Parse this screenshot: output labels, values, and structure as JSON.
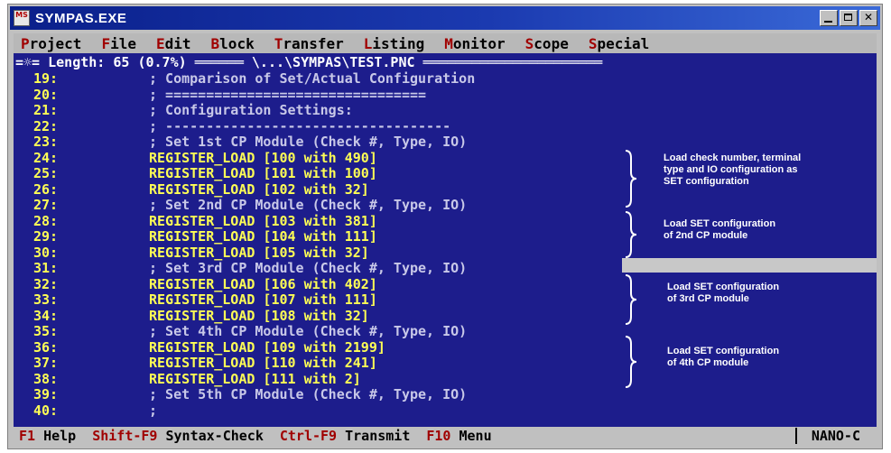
{
  "window": {
    "title": "SYMPAS.EXE",
    "icon_text": "MS",
    "buttons": [
      "minimize",
      "maximize",
      "close"
    ]
  },
  "menu": [
    {
      "hotkey": "P",
      "rest": "roject"
    },
    {
      "hotkey": "F",
      "rest": "ile"
    },
    {
      "hotkey": "E",
      "rest": "dit"
    },
    {
      "hotkey": "B",
      "rest": "lock"
    },
    {
      "hotkey": "T",
      "rest": "ransfer"
    },
    {
      "hotkey": "L",
      "rest": "isting"
    },
    {
      "hotkey": "M",
      "rest": "onitor"
    },
    {
      "hotkey": "S",
      "rest": "cope"
    },
    {
      "hotkey": "S",
      "rest": "pecial"
    }
  ],
  "status": "=☼= Length: 65 (0.7%) ══════ \\...\\SYMPAS\\TEST.PNC ══════════════════════",
  "lines": [
    {
      "num": "19:",
      "type": "comment",
      "text": "; Comparison of Set/Actual Configuration"
    },
    {
      "num": "20:",
      "type": "comment",
      "text": "; ================================"
    },
    {
      "num": "21:",
      "type": "comment",
      "text": "; Configuration Settings:"
    },
    {
      "num": "22:",
      "type": "comment",
      "text": "; -----------------------------------"
    },
    {
      "num": "23:",
      "type": "comment",
      "text": "; Set 1st CP Module (Check #, Type, IO)"
    },
    {
      "num": "24:",
      "type": "stmt",
      "text": "REGISTER_LOAD [100 with 490]"
    },
    {
      "num": "25:",
      "type": "stmt",
      "text": "REGISTER_LOAD [101 with 100]"
    },
    {
      "num": "26:",
      "type": "stmt",
      "text": "REGISTER_LOAD [102 with 32]"
    },
    {
      "num": "27:",
      "type": "comment",
      "text": "; Set 2nd CP Module (Check #, Type, IO)"
    },
    {
      "num": "28:",
      "type": "stmt",
      "text": "REGISTER_LOAD [103 with 381]"
    },
    {
      "num": "29:",
      "type": "stmt",
      "text": "REGISTER_LOAD [104 with 111]"
    },
    {
      "num": "30:",
      "type": "stmt",
      "text": "REGISTER_LOAD [105 with 32]"
    },
    {
      "num": "31:",
      "type": "comment",
      "text": "; Set 3rd CP Module (Check #, Type, IO)"
    },
    {
      "num": "32:",
      "type": "stmt",
      "text": "REGISTER_LOAD [106 with 402]"
    },
    {
      "num": "33:",
      "type": "stmt",
      "text": "REGISTER_LOAD [107 with 111]"
    },
    {
      "num": "34:",
      "type": "stmt",
      "text": "REGISTER_LOAD [108 with 32]"
    },
    {
      "num": "35:",
      "type": "comment",
      "text": "; Set 4th CP Module (Check #, Type, IO)"
    },
    {
      "num": "36:",
      "type": "stmt",
      "text": "REGISTER_LOAD [109 with 2199]"
    },
    {
      "num": "37:",
      "type": "stmt",
      "text": "REGISTER_LOAD [110 with 241]"
    },
    {
      "num": "38:",
      "type": "stmt",
      "text": "REGISTER_LOAD [111 with 2]"
    },
    {
      "num": "39:",
      "type": "comment",
      "text": "; Set 5th CP Module (Check #, Type, IO)"
    },
    {
      "num": "40:",
      "type": "comment",
      "text": ";"
    }
  ],
  "annotations": {
    "a1": [
      "Load check number, terminal",
      "type and IO configuration as",
      "SET configuration"
    ],
    "a2": [
      "Load SET configuration",
      "of 2nd CP module"
    ],
    "a3": [
      "Load SET configuration",
      "of 3rd CP module"
    ],
    "a4": [
      "Load SET configuration",
      "of 4th CP module"
    ]
  },
  "function_keys": [
    {
      "key": "F1",
      "label": " Help"
    },
    {
      "key": "Shift-F9",
      "label": " Syntax-Check"
    },
    {
      "key": "Ctrl-F9",
      "label": " Transmit"
    },
    {
      "key": "F10",
      "label": " Menu"
    }
  ],
  "model": "NANO-C",
  "colors": {
    "screen_bg": "#1d1d8c",
    "statement": "#ffff55",
    "comment": "#c8c8e8",
    "hotkey": "#a00000",
    "titlebar": "#0a1f8a"
  }
}
